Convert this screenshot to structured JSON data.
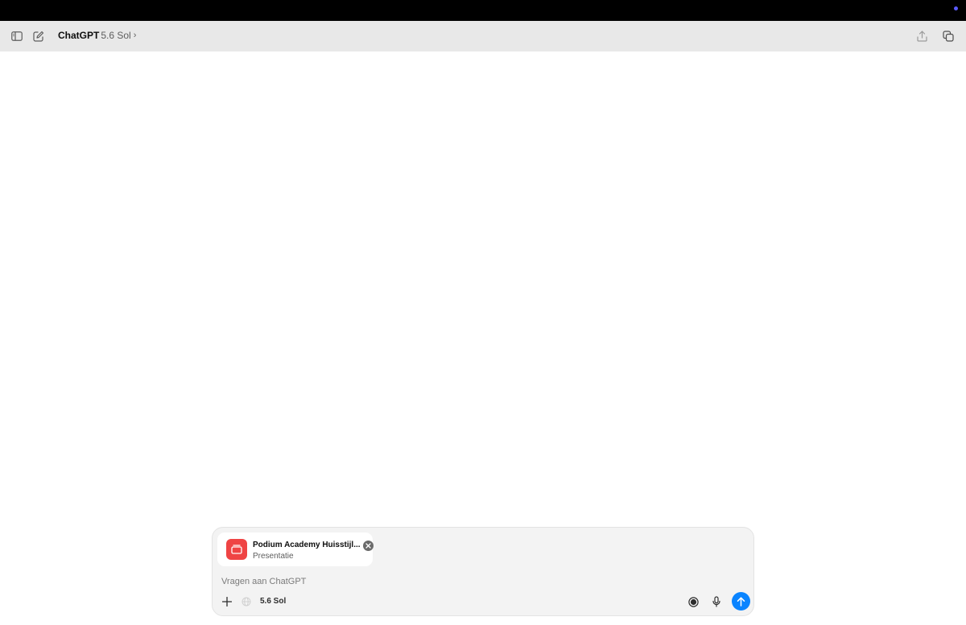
{
  "colors": {
    "status_bar": "#000000",
    "toolbar": "#e8e8e8",
    "composer": "#f3f3f3",
    "attachment_icon": "#ef4444",
    "send_button": "#0a84ff"
  },
  "toolbar": {
    "app_name": "ChatGPT",
    "model_version": "5.6 Sol",
    "chevron": "›",
    "icons": [
      "sidebar-icon",
      "new-chat-icon",
      "share-icon",
      "copy-icon"
    ]
  },
  "attachment": {
    "name": "Podium Academy Huisstijl...",
    "type": "Presentatie",
    "icon": "presentation-icon"
  },
  "composer": {
    "placeholder": "Vragen aan ChatGPT",
    "value": "",
    "model_chip": "5.6 Sol",
    "icons": [
      "plus-icon",
      "globe-icon",
      "voice-mode-icon",
      "microphone-icon",
      "send-icon"
    ]
  }
}
